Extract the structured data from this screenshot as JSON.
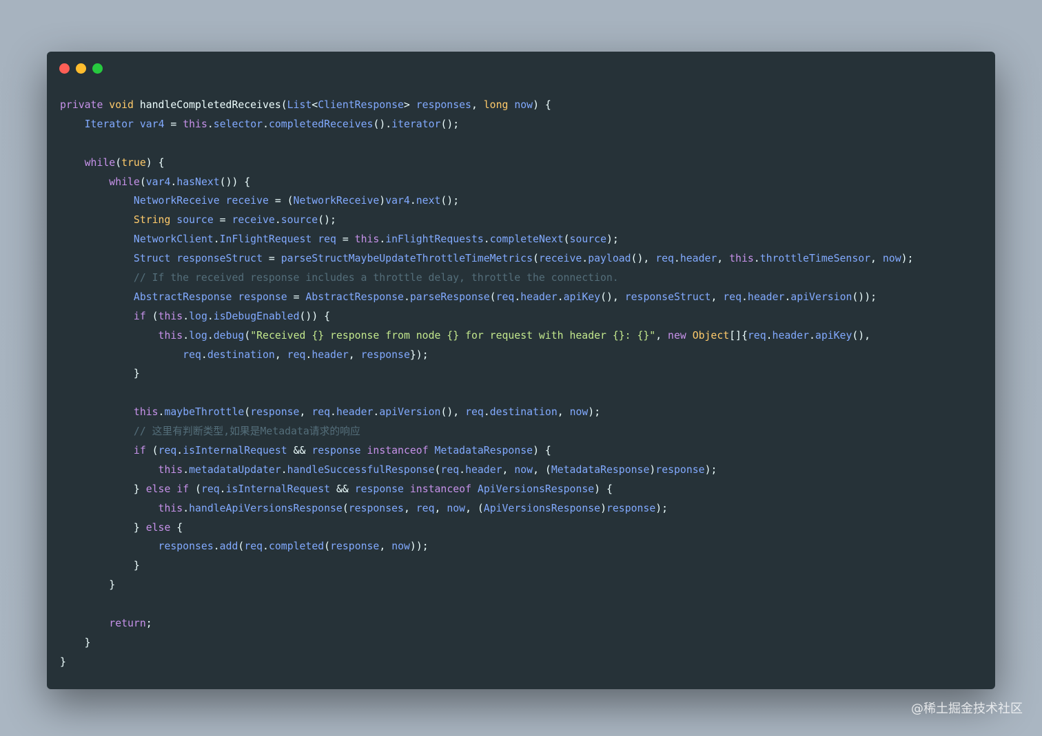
{
  "window": {
    "traffic_lights": [
      {
        "name": "close",
        "color": "#ff5f56"
      },
      {
        "name": "minimize",
        "color": "#ffbd2e"
      },
      {
        "name": "zoom",
        "color": "#27c93f"
      }
    ]
  },
  "code": {
    "lines": [
      [
        [
          "kw",
          "private"
        ],
        [
          "plain",
          " "
        ],
        [
          "type",
          "void"
        ],
        [
          "plain",
          " handleCompletedReceives("
        ],
        [
          "id",
          "List"
        ],
        [
          "plain",
          "<"
        ],
        [
          "id",
          "ClientResponse"
        ],
        [
          "plain",
          "> "
        ],
        [
          "id",
          "responses"
        ],
        [
          "plain",
          ", "
        ],
        [
          "type",
          "long"
        ],
        [
          "plain",
          " "
        ],
        [
          "id",
          "now"
        ],
        [
          "plain",
          ") {"
        ]
      ],
      [
        [
          "plain",
          "    "
        ],
        [
          "id",
          "Iterator"
        ],
        [
          "plain",
          " "
        ],
        [
          "id",
          "var4"
        ],
        [
          "plain",
          " = "
        ],
        [
          "kw",
          "this"
        ],
        [
          "plain",
          "."
        ],
        [
          "id",
          "selector"
        ],
        [
          "plain",
          "."
        ],
        [
          "id",
          "completedReceives"
        ],
        [
          "plain",
          "()."
        ],
        [
          "id",
          "iterator"
        ],
        [
          "plain",
          "();"
        ]
      ],
      [],
      [
        [
          "plain",
          "    "
        ],
        [
          "kw",
          "while"
        ],
        [
          "plain",
          "("
        ],
        [
          "type",
          "true"
        ],
        [
          "plain",
          ") {"
        ]
      ],
      [
        [
          "plain",
          "        "
        ],
        [
          "kw",
          "while"
        ],
        [
          "plain",
          "("
        ],
        [
          "id",
          "var4"
        ],
        [
          "plain",
          "."
        ],
        [
          "id",
          "hasNext"
        ],
        [
          "plain",
          "()) {"
        ]
      ],
      [
        [
          "plain",
          "            "
        ],
        [
          "id",
          "NetworkReceive"
        ],
        [
          "plain",
          " "
        ],
        [
          "id",
          "receive"
        ],
        [
          "plain",
          " = ("
        ],
        [
          "id",
          "NetworkReceive"
        ],
        [
          "plain",
          ")"
        ],
        [
          "id",
          "var4"
        ],
        [
          "plain",
          "."
        ],
        [
          "id",
          "next"
        ],
        [
          "plain",
          "();"
        ]
      ],
      [
        [
          "plain",
          "            "
        ],
        [
          "type",
          "String"
        ],
        [
          "plain",
          " "
        ],
        [
          "id",
          "source"
        ],
        [
          "plain",
          " = "
        ],
        [
          "id",
          "receive"
        ],
        [
          "plain",
          "."
        ],
        [
          "id",
          "source"
        ],
        [
          "plain",
          "();"
        ]
      ],
      [
        [
          "plain",
          "            "
        ],
        [
          "id",
          "NetworkClient"
        ],
        [
          "plain",
          "."
        ],
        [
          "id",
          "InFlightRequest"
        ],
        [
          "plain",
          " "
        ],
        [
          "id",
          "req"
        ],
        [
          "plain",
          " = "
        ],
        [
          "kw",
          "this"
        ],
        [
          "plain",
          "."
        ],
        [
          "id",
          "inFlightRequests"
        ],
        [
          "plain",
          "."
        ],
        [
          "id",
          "completeNext"
        ],
        [
          "plain",
          "("
        ],
        [
          "id",
          "source"
        ],
        [
          "plain",
          ");"
        ]
      ],
      [
        [
          "plain",
          "            "
        ],
        [
          "id",
          "Struct"
        ],
        [
          "plain",
          " "
        ],
        [
          "id",
          "responseStruct"
        ],
        [
          "plain",
          " = "
        ],
        [
          "id",
          "parseStructMaybeUpdateThrottleTimeMetrics"
        ],
        [
          "plain",
          "("
        ],
        [
          "id",
          "receive"
        ],
        [
          "plain",
          "."
        ],
        [
          "id",
          "payload"
        ],
        [
          "plain",
          "(), "
        ],
        [
          "id",
          "req"
        ],
        [
          "plain",
          "."
        ],
        [
          "id",
          "header"
        ],
        [
          "plain",
          ", "
        ],
        [
          "kw",
          "this"
        ],
        [
          "plain",
          "."
        ],
        [
          "id",
          "throttleTimeSensor"
        ],
        [
          "plain",
          ", "
        ],
        [
          "id",
          "now"
        ],
        [
          "plain",
          ");"
        ]
      ],
      [
        [
          "plain",
          "            "
        ],
        [
          "comment",
          "// If the received response includes a throttle delay, throttle the connection."
        ]
      ],
      [
        [
          "plain",
          "            "
        ],
        [
          "id",
          "AbstractResponse"
        ],
        [
          "plain",
          " "
        ],
        [
          "id",
          "response"
        ],
        [
          "plain",
          " = "
        ],
        [
          "id",
          "AbstractResponse"
        ],
        [
          "plain",
          "."
        ],
        [
          "id",
          "parseResponse"
        ],
        [
          "plain",
          "("
        ],
        [
          "id",
          "req"
        ],
        [
          "plain",
          "."
        ],
        [
          "id",
          "header"
        ],
        [
          "plain",
          "."
        ],
        [
          "id",
          "apiKey"
        ],
        [
          "plain",
          "(), "
        ],
        [
          "id",
          "responseStruct"
        ],
        [
          "plain",
          ", "
        ],
        [
          "id",
          "req"
        ],
        [
          "plain",
          "."
        ],
        [
          "id",
          "header"
        ],
        [
          "plain",
          "."
        ],
        [
          "id",
          "apiVersion"
        ],
        [
          "plain",
          "());"
        ]
      ],
      [
        [
          "plain",
          "            "
        ],
        [
          "kw",
          "if"
        ],
        [
          "plain",
          " ("
        ],
        [
          "kw",
          "this"
        ],
        [
          "plain",
          "."
        ],
        [
          "id",
          "log"
        ],
        [
          "plain",
          "."
        ],
        [
          "id",
          "isDebugEnabled"
        ],
        [
          "plain",
          "()) {"
        ]
      ],
      [
        [
          "plain",
          "                "
        ],
        [
          "kw",
          "this"
        ],
        [
          "plain",
          "."
        ],
        [
          "id",
          "log"
        ],
        [
          "plain",
          "."
        ],
        [
          "id",
          "debug"
        ],
        [
          "plain",
          "("
        ],
        [
          "str",
          "\"Received {} response from node {} for request with header {}: {}\""
        ],
        [
          "plain",
          ", "
        ],
        [
          "kw",
          "new"
        ],
        [
          "plain",
          " "
        ],
        [
          "type",
          "Object"
        ],
        [
          "plain",
          "[]{"
        ],
        [
          "id",
          "req"
        ],
        [
          "plain",
          "."
        ],
        [
          "id",
          "header"
        ],
        [
          "plain",
          "."
        ],
        [
          "id",
          "apiKey"
        ],
        [
          "plain",
          "(),"
        ]
      ],
      [
        [
          "plain",
          "                    "
        ],
        [
          "id",
          "req"
        ],
        [
          "plain",
          "."
        ],
        [
          "id",
          "destination"
        ],
        [
          "plain",
          ", "
        ],
        [
          "id",
          "req"
        ],
        [
          "plain",
          "."
        ],
        [
          "id",
          "header"
        ],
        [
          "plain",
          ", "
        ],
        [
          "id",
          "response"
        ],
        [
          "plain",
          "});"
        ]
      ],
      [
        [
          "plain",
          "            }"
        ]
      ],
      [],
      [
        [
          "plain",
          "            "
        ],
        [
          "kw",
          "this"
        ],
        [
          "plain",
          "."
        ],
        [
          "id",
          "maybeThrottle"
        ],
        [
          "plain",
          "("
        ],
        [
          "id",
          "response"
        ],
        [
          "plain",
          ", "
        ],
        [
          "id",
          "req"
        ],
        [
          "plain",
          "."
        ],
        [
          "id",
          "header"
        ],
        [
          "plain",
          "."
        ],
        [
          "id",
          "apiVersion"
        ],
        [
          "plain",
          "(), "
        ],
        [
          "id",
          "req"
        ],
        [
          "plain",
          "."
        ],
        [
          "id",
          "destination"
        ],
        [
          "plain",
          ", "
        ],
        [
          "id",
          "now"
        ],
        [
          "plain",
          ");"
        ]
      ],
      [
        [
          "plain",
          "            "
        ],
        [
          "comment",
          "// 这里有判断类型,如果是Metadata请求的响应"
        ]
      ],
      [
        [
          "plain",
          "            "
        ],
        [
          "kw",
          "if"
        ],
        [
          "plain",
          " ("
        ],
        [
          "id",
          "req"
        ],
        [
          "plain",
          "."
        ],
        [
          "id",
          "isInternalRequest"
        ],
        [
          "plain",
          " && "
        ],
        [
          "id",
          "response"
        ],
        [
          "plain",
          " "
        ],
        [
          "kw",
          "instanceof"
        ],
        [
          "plain",
          " "
        ],
        [
          "id",
          "MetadataResponse"
        ],
        [
          "plain",
          ") {"
        ]
      ],
      [
        [
          "plain",
          "                "
        ],
        [
          "kw",
          "this"
        ],
        [
          "plain",
          "."
        ],
        [
          "id",
          "metadataUpdater"
        ],
        [
          "plain",
          "."
        ],
        [
          "id",
          "handleSuccessfulResponse"
        ],
        [
          "plain",
          "("
        ],
        [
          "id",
          "req"
        ],
        [
          "plain",
          "."
        ],
        [
          "id",
          "header"
        ],
        [
          "plain",
          ", "
        ],
        [
          "id",
          "now"
        ],
        [
          "plain",
          ", ("
        ],
        [
          "id",
          "MetadataResponse"
        ],
        [
          "plain",
          ")"
        ],
        [
          "id",
          "response"
        ],
        [
          "plain",
          ");"
        ]
      ],
      [
        [
          "plain",
          "            } "
        ],
        [
          "kw",
          "else"
        ],
        [
          "plain",
          " "
        ],
        [
          "kw",
          "if"
        ],
        [
          "plain",
          " ("
        ],
        [
          "id",
          "req"
        ],
        [
          "plain",
          "."
        ],
        [
          "id",
          "isInternalRequest"
        ],
        [
          "plain",
          " && "
        ],
        [
          "id",
          "response"
        ],
        [
          "plain",
          " "
        ],
        [
          "kw",
          "instanceof"
        ],
        [
          "plain",
          " "
        ],
        [
          "id",
          "ApiVersionsResponse"
        ],
        [
          "plain",
          ") {"
        ]
      ],
      [
        [
          "plain",
          "                "
        ],
        [
          "kw",
          "this"
        ],
        [
          "plain",
          "."
        ],
        [
          "id",
          "handleApiVersionsResponse"
        ],
        [
          "plain",
          "("
        ],
        [
          "id",
          "responses"
        ],
        [
          "plain",
          ", "
        ],
        [
          "id",
          "req"
        ],
        [
          "plain",
          ", "
        ],
        [
          "id",
          "now"
        ],
        [
          "plain",
          ", ("
        ],
        [
          "id",
          "ApiVersionsResponse"
        ],
        [
          "plain",
          ")"
        ],
        [
          "id",
          "response"
        ],
        [
          "plain",
          ");"
        ]
      ],
      [
        [
          "plain",
          "            } "
        ],
        [
          "kw",
          "else"
        ],
        [
          "plain",
          " {"
        ]
      ],
      [
        [
          "plain",
          "                "
        ],
        [
          "id",
          "responses"
        ],
        [
          "plain",
          "."
        ],
        [
          "id",
          "add"
        ],
        [
          "plain",
          "("
        ],
        [
          "id",
          "req"
        ],
        [
          "plain",
          "."
        ],
        [
          "id",
          "completed"
        ],
        [
          "plain",
          "("
        ],
        [
          "id",
          "response"
        ],
        [
          "plain",
          ", "
        ],
        [
          "id",
          "now"
        ],
        [
          "plain",
          "));"
        ]
      ],
      [
        [
          "plain",
          "            }"
        ]
      ],
      [
        [
          "plain",
          "        }"
        ]
      ],
      [],
      [
        [
          "plain",
          "        "
        ],
        [
          "kw",
          "return"
        ],
        [
          "plain",
          ";"
        ]
      ],
      [
        [
          "plain",
          "    }"
        ]
      ],
      [
        [
          "plain",
          "}"
        ]
      ]
    ]
  },
  "watermark": "@稀土掘金技术社区"
}
